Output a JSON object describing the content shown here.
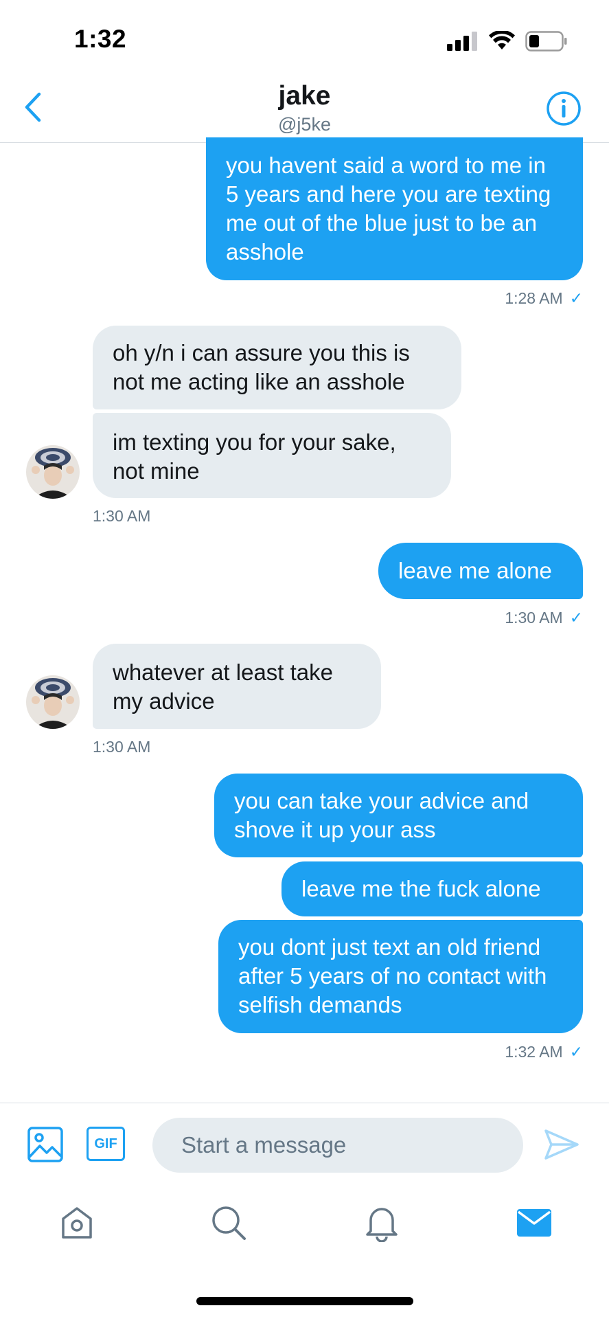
{
  "status_bar": {
    "time": "1:32"
  },
  "header": {
    "name": "jake",
    "handle": "@j5ke"
  },
  "messages": [
    {
      "direction": "sent",
      "text": "you havent said a word to me in 5 years and here you are texting me out of the blue just to be an asshole"
    },
    {
      "direction": "sent",
      "timestamp": "1:28 AM"
    },
    {
      "direction": "received",
      "text": "oh y/n i can assure you this is not me acting like an asshole"
    },
    {
      "direction": "received",
      "text": "im texting you for your sake, not mine",
      "timestamp": "1:30 AM"
    },
    {
      "direction": "sent",
      "text": "leave me alone",
      "timestamp": "1:30 AM"
    },
    {
      "direction": "received",
      "text": "whatever at least take my advice",
      "timestamp": "1:30 AM"
    },
    {
      "direction": "sent",
      "text": "you can take your advice and shove it up your ass"
    },
    {
      "direction": "sent",
      "text": "leave me the fuck alone"
    },
    {
      "direction": "sent",
      "text": "you dont just text an old friend after 5 years of no contact with selfish demands",
      "timestamp": "1:32 AM"
    }
  ],
  "composer": {
    "placeholder": "Start a message",
    "gif_label": "GIF"
  },
  "icons": {
    "back": "chevron-left-icon",
    "info": "info-icon",
    "image": "image-icon",
    "gif": "gif-icon",
    "send": "send-icon",
    "home": "home-icon",
    "search": "search-icon",
    "notifications": "bell-icon",
    "messages": "mail-icon"
  },
  "colors": {
    "accent": "#1da1f2",
    "received_bubble": "#e6ecf0",
    "muted_text": "#657786"
  }
}
